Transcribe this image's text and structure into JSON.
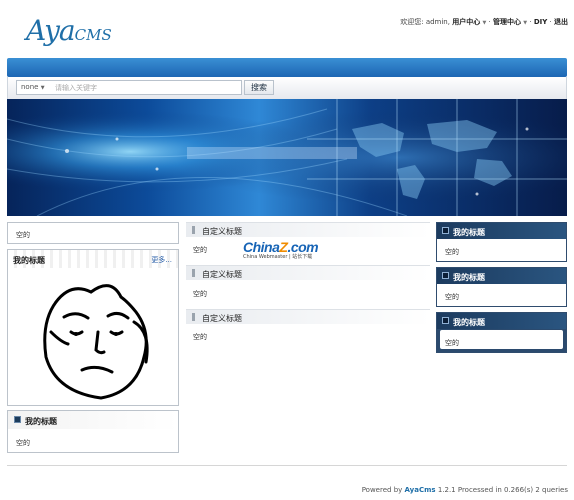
{
  "logo": {
    "big": "Aya",
    "small": "CMS"
  },
  "topnav": {
    "welcome": "欢迎您:",
    "user": "admin,",
    "user_center": "用户中心",
    "manage_center": "管理中心",
    "diy": "DIY",
    "logout": "退出",
    "sep": "·"
  },
  "search": {
    "select_value": "none",
    "placeholder": "请输入关键字",
    "button": "搜索"
  },
  "left": {
    "empty_text": "空的",
    "image_box": {
      "title": "我的标题",
      "more": "更多..."
    },
    "title_box": {
      "title": "我的标题",
      "text": "空的"
    }
  },
  "middle": [
    {
      "title": "自定义标题",
      "text": "空的"
    },
    {
      "title": "自定义标题",
      "text": "空的"
    },
    {
      "title": "自定义标题",
      "text": "空的"
    }
  ],
  "watermark": {
    "brand": "China",
    "brand_z": "Z",
    "brand_tail": ".com",
    "sub": "China Webmaster | 站长下载"
  },
  "right": [
    {
      "title": "我的标题",
      "text": "空的"
    },
    {
      "title": "我的标题",
      "text": "空的"
    },
    {
      "title": "我的标题",
      "text": "空的"
    }
  ],
  "footer": {
    "prefix": "Powered by",
    "brand": "AyaCms",
    "suffix": "1.2.1 Processed in 0.266(s) 2 queries"
  },
  "colors": {
    "accent": "#1f6fa8",
    "nav_bar": "#1d66b3",
    "box_header": "#1c3b5f"
  },
  "icons": {
    "dropdown": "caret-down-icon",
    "box_marker": "square-bullet-icon"
  }
}
